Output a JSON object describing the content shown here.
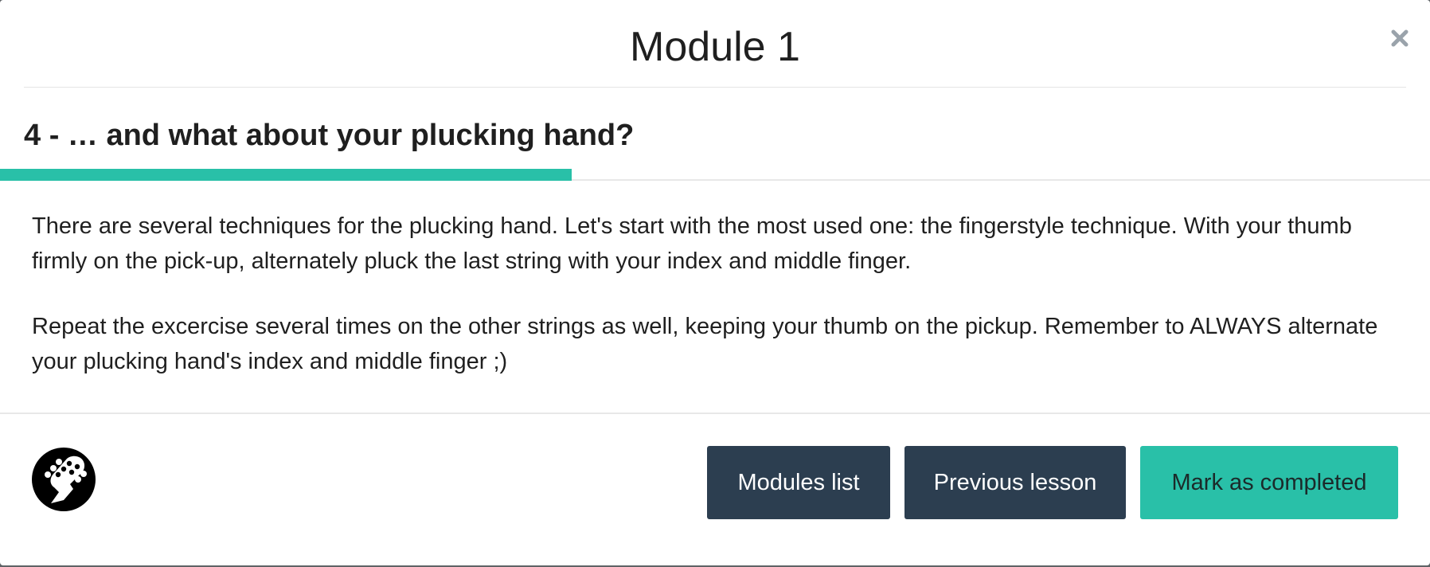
{
  "modal": {
    "title": "Module 1",
    "close_label": "×"
  },
  "lesson": {
    "title": "4 - … and what about your plucking hand?",
    "progress_percent": 40,
    "paragraphs": [
      "There are several techniques for the plucking hand. Let's start with the most used one: the fingerstyle technique. With your thumb firmly on the pick-up, alternately pluck the last string with your index and middle finger.",
      "Repeat the excercise several times on the other strings as well, keeping your thumb on the pickup. Remember to ALWAYS alternate your plucking hand's index and middle finger ;)"
    ]
  },
  "footer": {
    "logo_icon": "bass-headstock-icon",
    "buttons": {
      "modules_list": "Modules list",
      "previous_lesson": "Previous lesson",
      "mark_completed": "Mark as completed"
    }
  },
  "colors": {
    "accent": "#29c0a8",
    "dark_button": "#2c3e50"
  }
}
